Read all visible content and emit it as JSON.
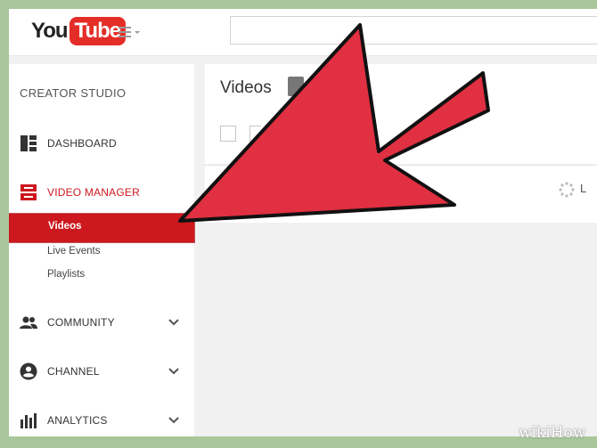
{
  "header": {
    "logo_you": "You",
    "logo_tube": "Tube",
    "search_placeholder": ""
  },
  "sidebar": {
    "title": "CREATOR STUDIO",
    "items": [
      {
        "label": "DASHBOARD",
        "icon": "dashboard-icon"
      },
      {
        "label": "VIDEO MANAGER",
        "icon": "video-manager-icon"
      },
      {
        "label": "COMMUNITY",
        "icon": "community-icon"
      },
      {
        "label": "CHANNEL",
        "icon": "channel-icon"
      },
      {
        "label": "ANALYTICS",
        "icon": "analytics-icon"
      }
    ],
    "subitems": [
      {
        "label": "Videos"
      },
      {
        "label": "Live Events"
      },
      {
        "label": "Playlists"
      }
    ]
  },
  "main": {
    "title": "Videos",
    "loading_text": "L"
  },
  "watermark": {
    "text": "wikiHow"
  },
  "colors": {
    "accent": "#cc181e",
    "arrow": "#e03041",
    "background": "#a9c79b"
  }
}
